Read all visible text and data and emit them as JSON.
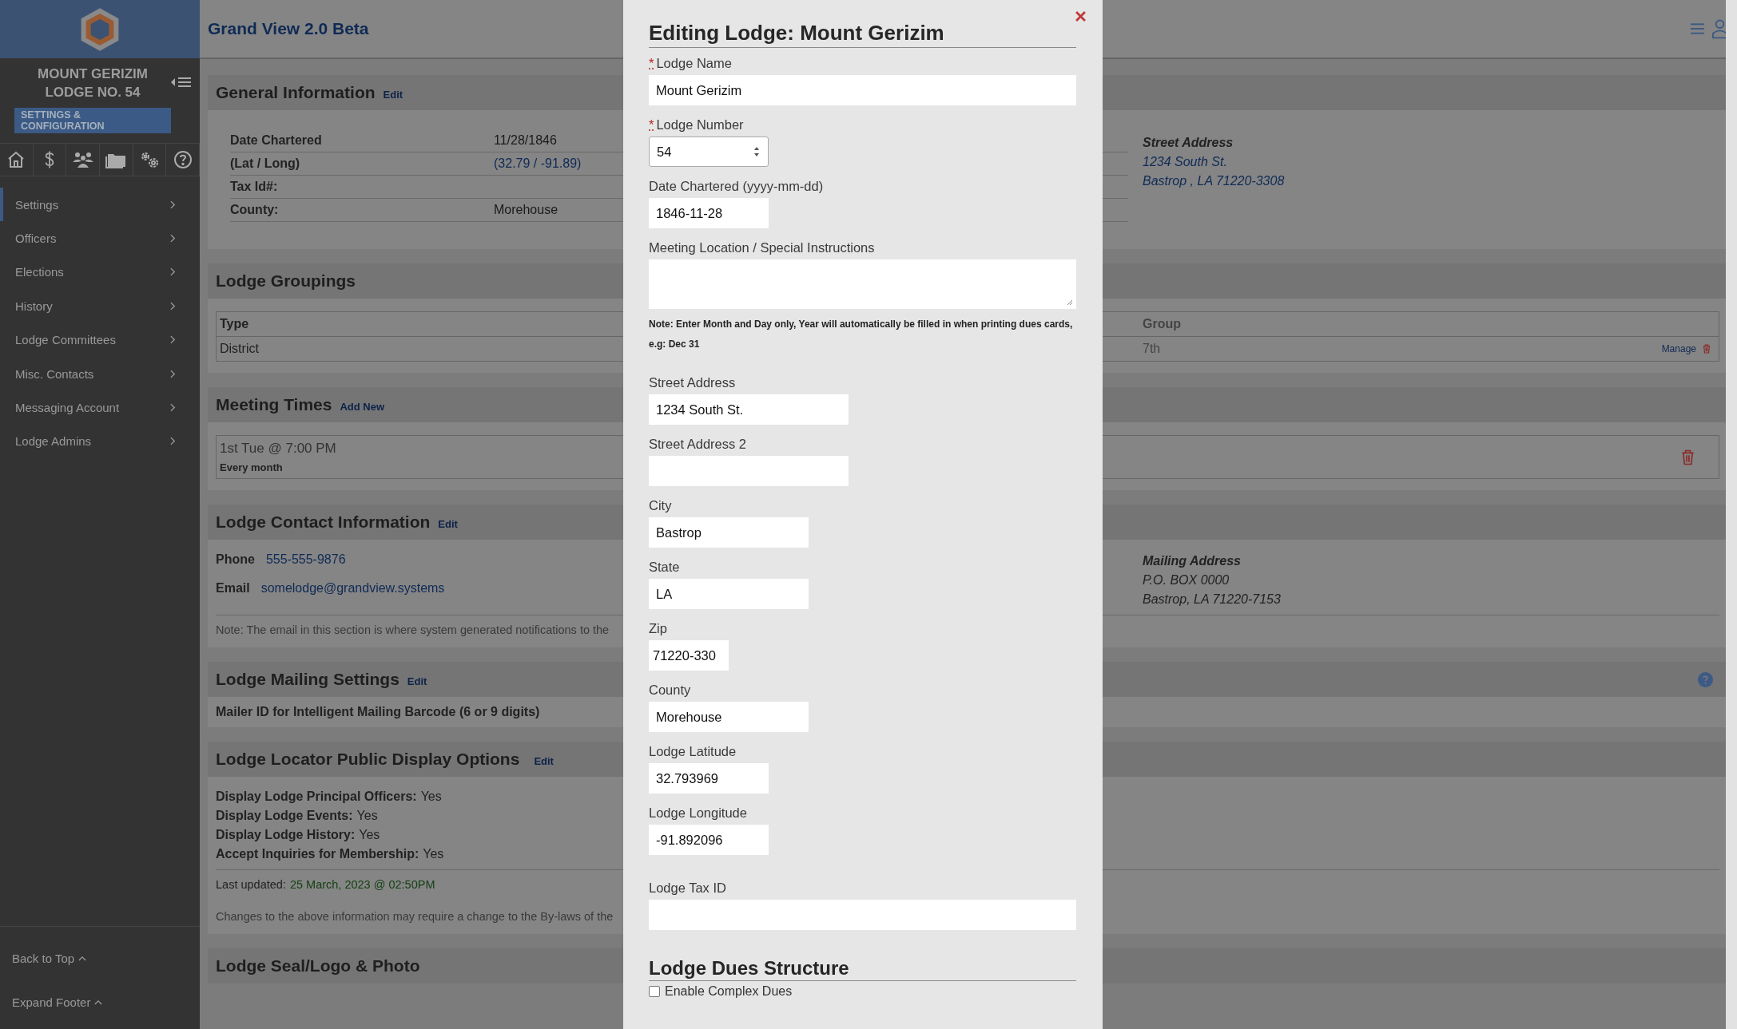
{
  "app": {
    "title": "Grand View 2.0 Beta"
  },
  "sidebar": {
    "lodge_name": "MOUNT GERIZIM",
    "lodge_number": "LODGE NO. 54",
    "badge": "SETTINGS & CONFIGURATION",
    "menu": [
      {
        "label": "Settings",
        "selected": true
      },
      {
        "label": "Officers",
        "selected": false
      },
      {
        "label": "Elections",
        "selected": false
      },
      {
        "label": "History",
        "selected": false
      },
      {
        "label": "Lodge Committees",
        "selected": false
      },
      {
        "label": "Misc. Contacts",
        "selected": false
      },
      {
        "label": "Messaging Account",
        "selected": false
      },
      {
        "label": "Lodge Admins",
        "selected": false
      }
    ],
    "footer_links": [
      "Back to Top",
      "Expand Footer"
    ]
  },
  "general": {
    "title": "General Information",
    "action": "Edit",
    "rows": [
      {
        "label": "Date Chartered",
        "value": "11/28/1846",
        "kind": "text"
      },
      {
        "label": "(Lat / Long)",
        "value": "(32.79 / -91.89)",
        "kind": "link"
      },
      {
        "label": "Tax Id#:",
        "kind": "text"
      },
      {
        "label": "County:",
        "value": "Morehouse",
        "kind": "text"
      }
    ],
    "address": {
      "heading": "Street Address",
      "lines": [
        "1234 South St.",
        "Bastrop , LA  71220-3308"
      ]
    }
  },
  "groupings": {
    "title": "Lodge Groupings",
    "columns": [
      "Type",
      "Group"
    ],
    "rows": [
      {
        "cells": [
          "District",
          "7th"
        ],
        "action": "Manage"
      }
    ]
  },
  "meeting_times": {
    "title": "Meeting Times",
    "action": "Add New",
    "items": [
      {
        "time": "1st Tue @ 7:00 PM",
        "repeat": "Every month"
      }
    ]
  },
  "contact": {
    "title": "Lodge Contact Information",
    "action": "Edit",
    "phone_label": "Phone",
    "phone": "555-555-9876",
    "email_label": "Email",
    "email": "somelodge@grandview.systems",
    "note": "Note: The email in this section is where system generated notifications to the",
    "mailing": {
      "heading": "Mailing Address",
      "lines": [
        "P.O. BOX 0000",
        "Bastrop, LA 71220-7153"
      ]
    }
  },
  "mailing_settings": {
    "title": "Lodge Mailing Settings",
    "action": "Edit",
    "label": "Mailer ID for Intelligent Mailing Barcode (6 or 9 digits)"
  },
  "locator": {
    "title": "Lodge Locator Public Display Options",
    "action": "Edit",
    "options": [
      {
        "label": "Display Lodge Principal Officers:",
        "value": "Yes"
      },
      {
        "label": "Display Lodge Events:",
        "value": "Yes"
      },
      {
        "label": "Display Lodge History:",
        "value": "Yes"
      },
      {
        "label": "Accept Inquiries for Membership:",
        "value": "Yes"
      }
    ],
    "updated_label": "Last updated:",
    "updated": "25 March, 2023 @ 02:50PM",
    "changes_note": "Changes to the above information may require a change to the By-laws of the"
  },
  "seal": {
    "title": "Lodge Seal/Logo & Photo"
  },
  "modal": {
    "title": "Editing Lodge: Mount Gerizim",
    "required_mark": "*",
    "fields": [
      {
        "label": "Lodge Name",
        "required": true,
        "kind": "text",
        "value": "Mount Gerizim"
      },
      {
        "label": "Lodge Number",
        "required": true,
        "kind": "number",
        "value": "54"
      },
      {
        "label": "Date Chartered (yyyy-mm-dd)",
        "required": false,
        "kind": "text",
        "value": "1846-11-28"
      },
      {
        "label": "Meeting Location / Special Instructions",
        "required": false,
        "kind": "textarea"
      }
    ],
    "note": "Note: Enter Month and Day only, Year will automatically be filled in when printing dues cards, e.g: Dec 31",
    "address_fields": [
      {
        "label": "Street Address",
        "value": "1234 South St."
      },
      {
        "label": "Street Address 2"
      },
      {
        "label": "City",
        "value": "Bastrop"
      },
      {
        "label": "State",
        "value": "LA"
      },
      {
        "label": "Zip",
        "value": "71220-330"
      },
      {
        "label": "County",
        "value": "Morehouse"
      },
      {
        "label": "Lodge Latitude",
        "value": "32.793969"
      },
      {
        "label": "Lodge Longitude",
        "value": "-91.892096"
      }
    ],
    "tax_field": {
      "label": "Lodge Tax ID"
    },
    "dues": {
      "title": "Lodge Dues Structure",
      "option": {
        "label": "Enable Complex Dues",
        "checked": false
      }
    }
  }
}
